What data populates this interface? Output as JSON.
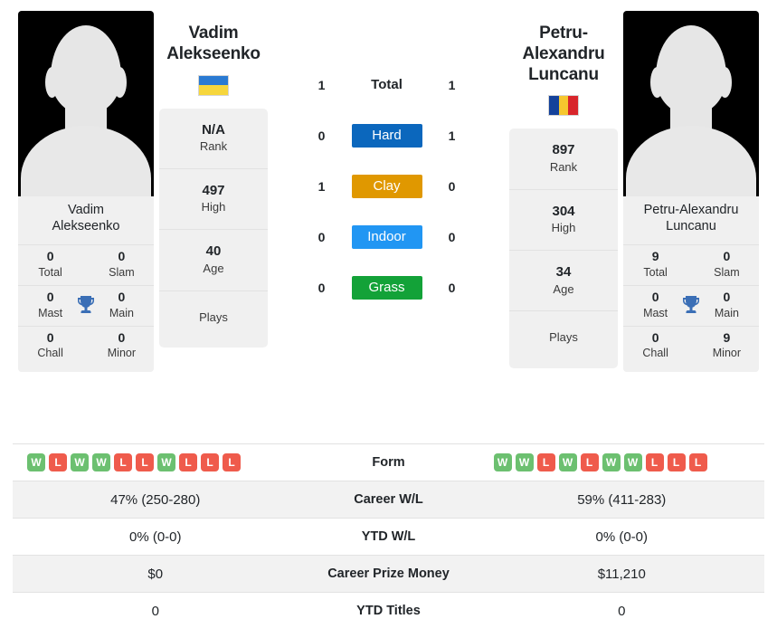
{
  "colors": {
    "hard": "#0b67bd",
    "clay": "#e09800",
    "indoor": "#2196f3",
    "grass": "#13a238",
    "win": "#6cc070",
    "loss": "#ef5b4c",
    "trophy": "#3b6fb6",
    "card_bg": "#f0f0f0",
    "row_alt": "#f2f2f2"
  },
  "player_left": {
    "name": "Vadim Alekseenko",
    "first_name": "Vadim",
    "last_name": "Alekseenko",
    "photo_caption_line1": "Vadim",
    "photo_caption_line2": "Alekseenko",
    "country": "Ukraine",
    "flag_colors": [
      "#2a7ad2",
      "#f6d63c"
    ],
    "flag_orientation": "horizontal",
    "info": [
      {
        "value": "N/A",
        "label": "Rank"
      },
      {
        "value": "497",
        "label": "High"
      },
      {
        "value": "40",
        "label": "Age"
      },
      {
        "value": "",
        "label": "Plays"
      }
    ],
    "titles": [
      {
        "value": "0",
        "label": "Total"
      },
      {
        "value": "0",
        "label": "Slam"
      },
      {
        "value": "0",
        "label": "Mast"
      },
      {
        "value": "0",
        "label": "Main"
      },
      {
        "value": "0",
        "label": "Chall"
      },
      {
        "value": "0",
        "label": "Minor"
      }
    ],
    "form": [
      "W",
      "L",
      "W",
      "W",
      "L",
      "L",
      "W",
      "L",
      "L",
      "L"
    ],
    "career_wl": "47% (250-280)",
    "ytd_wl": "0% (0-0)",
    "career_prize_money": "$0",
    "ytd_titles": "0"
  },
  "player_right": {
    "name": "Petru-Alexandru Luncanu",
    "first_name": "Petru-Alexandru",
    "last_name": "Luncanu",
    "photo_caption_line1": "Petru-Alexandru",
    "photo_caption_line2": "Luncanu",
    "country": "Romania",
    "flag_colors": [
      "#14429b",
      "#f6c72e",
      "#d8252b"
    ],
    "flag_orientation": "vertical",
    "info": [
      {
        "value": "897",
        "label": "Rank"
      },
      {
        "value": "304",
        "label": "High"
      },
      {
        "value": "34",
        "label": "Age"
      },
      {
        "value": "",
        "label": "Plays"
      }
    ],
    "titles": [
      {
        "value": "9",
        "label": "Total"
      },
      {
        "value": "0",
        "label": "Slam"
      },
      {
        "value": "0",
        "label": "Mast"
      },
      {
        "value": "0",
        "label": "Main"
      },
      {
        "value": "0",
        "label": "Chall"
      },
      {
        "value": "9",
        "label": "Minor"
      }
    ],
    "form": [
      "W",
      "W",
      "L",
      "W",
      "L",
      "W",
      "W",
      "L",
      "L",
      "L"
    ],
    "career_wl": "59% (411-283)",
    "ytd_wl": "0% (0-0)",
    "career_prize_money": "$11,210",
    "ytd_titles": "0"
  },
  "surfaces": [
    {
      "label": "Total",
      "left": "1",
      "right": "1",
      "key": "total"
    },
    {
      "label": "Hard",
      "left": "0",
      "right": "1",
      "key": "hard"
    },
    {
      "label": "Clay",
      "left": "1",
      "right": "0",
      "key": "clay"
    },
    {
      "label": "Indoor",
      "left": "0",
      "right": "0",
      "key": "indoor"
    },
    {
      "label": "Grass",
      "left": "0",
      "right": "0",
      "key": "grass"
    }
  ],
  "comparison_rows": [
    {
      "label": "Form",
      "key": "form"
    },
    {
      "label": "Career W/L",
      "key": "career_wl"
    },
    {
      "label": "YTD W/L",
      "key": "ytd_wl"
    },
    {
      "label": "Career Prize Money",
      "key": "career_prize_money"
    },
    {
      "label": "YTD Titles",
      "key": "ytd_titles"
    }
  ],
  "icons": {
    "trophy": "trophy-icon",
    "avatar": "avatar-placeholder-icon"
  }
}
